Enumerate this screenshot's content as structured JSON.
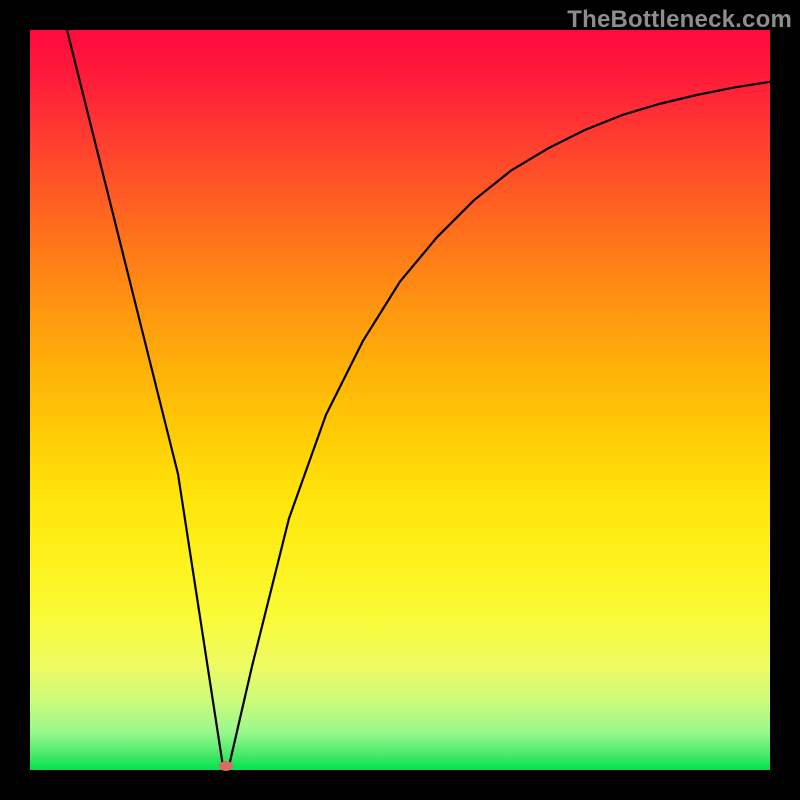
{
  "watermark": "TheBottleneck.com",
  "chart_data": {
    "type": "line",
    "title": "",
    "xlabel": "",
    "ylabel": "",
    "xlim": [
      0,
      100
    ],
    "ylim": [
      0,
      100
    ],
    "grid": false,
    "legend": false,
    "series": [
      {
        "name": "curve",
        "x": [
          5,
          10,
          15,
          20,
          24,
          26,
          27,
          30,
          35,
          40,
          45,
          50,
          55,
          60,
          65,
          70,
          75,
          80,
          85,
          90,
          95,
          100
        ],
        "y": [
          100,
          80,
          60,
          40,
          14,
          1,
          1,
          14,
          34,
          48,
          58,
          66,
          72,
          77,
          81,
          84,
          86.5,
          88.5,
          90,
          91.2,
          92.2,
          93
        ]
      }
    ],
    "background_gradient": {
      "direction": "vertical",
      "stops": [
        {
          "pos": 0,
          "color": "#ff0a3e"
        },
        {
          "pos": 50,
          "color": "#ffcd05"
        },
        {
          "pos": 85,
          "color": "#eefb64"
        },
        {
          "pos": 100,
          "color": "#00e24d"
        }
      ]
    },
    "marker": {
      "x": 26.5,
      "y": 0.5,
      "color": "#d86b65"
    }
  }
}
